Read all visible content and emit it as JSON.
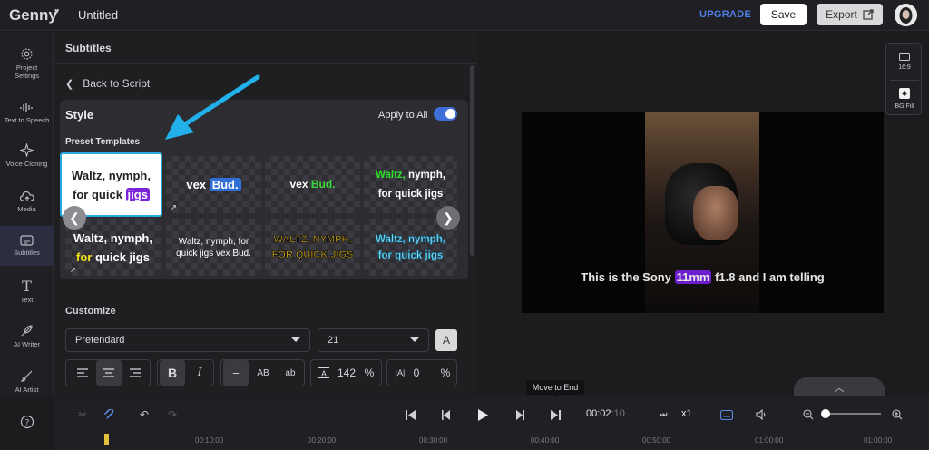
{
  "app": {
    "logo": "Genny",
    "doc_title": "Untitled"
  },
  "header": {
    "upgrade": "UPGRADE",
    "save": "Save",
    "export": "Export"
  },
  "sidebar": {
    "items": [
      {
        "label": "Project Settings",
        "icon": "gear-icon"
      },
      {
        "label": "Text to Speech",
        "icon": "waveform-icon"
      },
      {
        "label": "Voice Cloning",
        "icon": "sparkle-icon"
      },
      {
        "label": "Media",
        "icon": "cloud-upload-icon"
      },
      {
        "label": "Subtitles",
        "icon": "subtitles-icon"
      },
      {
        "label": "Text",
        "icon": "text-icon"
      },
      {
        "label": "AI Writer",
        "icon": "feather-icon"
      },
      {
        "label": "AI Artist",
        "icon": "brush-icon"
      }
    ]
  },
  "panel": {
    "title": "Subtitles",
    "back": "Back to Script",
    "style_title": "Style",
    "apply_to_all": "Apply to All",
    "apply_to_all_on": true,
    "preset_label": "Preset Templates",
    "templates": [
      {
        "line1": "Waltz, nymph,",
        "line2a": "for quick ",
        "line2b": "jigs"
      },
      {
        "a": "vex ",
        "b": "Bud."
      },
      {
        "a": "vex ",
        "b": "Bud."
      },
      {
        "a": "Waltz,",
        "b": " nymph,",
        "line2": "for quick jigs"
      },
      {
        "line1": "Waltz, nymph,",
        "line2a": "for",
        "line2b": " quick jigs"
      },
      {
        "line1": "Waltz, nymph, for",
        "line2": "quick jigs vex Bud."
      },
      {
        "line1": "WALTZ, NYMPH,",
        "line2": "FOR QUICK JIGS"
      },
      {
        "line1": "Waltz, nymph,",
        "line2": "for quick jigs"
      }
    ],
    "customize": "Customize",
    "font": "Pretendard",
    "font_size": "21",
    "font_color_label": "A",
    "format": {
      "bold": "B",
      "italic": "I",
      "dash": "−",
      "upper": "AB",
      "lower": "ab",
      "line_height": "142",
      "letter_spacing": "0",
      "percent": "%"
    }
  },
  "preview": {
    "subtitle_pre": "This is the Sony ",
    "subtitle_hl": "11mm",
    "subtitle_post": " f1.8 and I am telling",
    "ratio_label": "16:9",
    "bg_label": "BG Fill"
  },
  "timeline": {
    "tooltip": "Move to End",
    "time_main": "00:02",
    "time_frac": ":10",
    "speed": "x1",
    "ruler": [
      "00:10:00",
      "00:20:00",
      "00:30:00",
      "00:40:00",
      "00:50:00",
      "01:00:00"
    ]
  },
  "colors": {
    "accent": "#3e6fd8",
    "highlight": "#7b23d6",
    "selection": "#27a9e0"
  }
}
